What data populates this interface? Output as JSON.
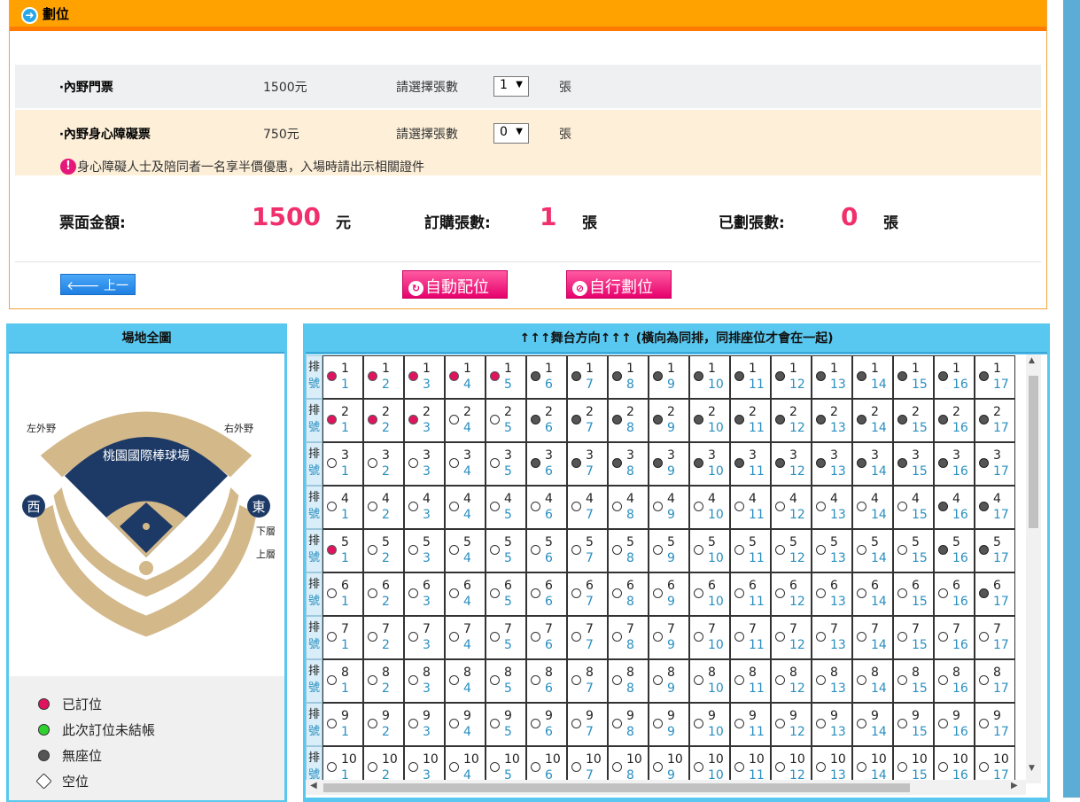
{
  "header": {
    "title": "劃位",
    "icon": "arrow-right-icon"
  },
  "tickets": [
    {
      "name": "‧內野門票",
      "price": "1500元",
      "prompt": "請選擇張數",
      "qty": "1",
      "unit": "張"
    },
    {
      "name": "‧內野身心障礙票",
      "price": "750元",
      "prompt": "請選擇張數",
      "qty": "0",
      "unit": "張",
      "note": "身心障礙人士及陪同者一名享半價優惠，入場時請出示相關證件"
    }
  ],
  "summary": {
    "amount_label": "票面金額:",
    "amount": "1500",
    "amount_unit": "元",
    "ordered_label": "訂購張數:",
    "ordered": "1",
    "ordered_unit": "張",
    "assigned_label": "已劃張數:",
    "assigned": "0",
    "assigned_unit": "張"
  },
  "buttons": {
    "back": "上一步",
    "auto": "自動配位",
    "self": "自行劃位"
  },
  "map": {
    "title": "場地全圖",
    "venue_name": "桃園國際棒球場",
    "labels": {
      "left_outfield": "左外野",
      "right_outfield": "右外野",
      "west": "西",
      "east": "東",
      "lower": "下層",
      "upper": "上層"
    }
  },
  "legend": [
    {
      "label": "已訂位",
      "color": "#e0145e",
      "state": "booked"
    },
    {
      "label": "此次訂位未結帳",
      "color": "#2ed12e",
      "state": "pending"
    },
    {
      "label": "無座位",
      "color": "#555555",
      "state": "noseat"
    },
    {
      "label": "空位",
      "color": "#ffffff",
      "state": "empty"
    }
  ],
  "seat_panel": {
    "title": "↑↑↑舞台方向↑↑↑ (橫向為同排，同排座位才會在一起)",
    "row_head_top": "排",
    "row_head_bottom": "號",
    "visible_rows": [
      1,
      2,
      3,
      4,
      5,
      6,
      7,
      8,
      9,
      10
    ],
    "visible_seats": [
      1,
      2,
      3,
      4,
      5,
      6,
      7,
      8,
      9,
      10,
      11,
      12,
      13,
      14,
      15,
      16,
      17
    ],
    "status_rows": [
      [
        "booked",
        "booked",
        "booked",
        "booked",
        "booked",
        "noseat",
        "noseat",
        "noseat",
        "noseat",
        "noseat",
        "noseat",
        "noseat",
        "noseat",
        "noseat",
        "noseat",
        "noseat",
        "noseat"
      ],
      [
        "booked",
        "booked",
        "booked",
        "empty",
        "empty",
        "noseat",
        "noseat",
        "noseat",
        "noseat",
        "noseat",
        "noseat",
        "noseat",
        "noseat",
        "noseat",
        "noseat",
        "noseat",
        "noseat"
      ],
      [
        "empty",
        "empty",
        "empty",
        "empty",
        "empty",
        "noseat",
        "noseat",
        "noseat",
        "noseat",
        "noseat",
        "noseat",
        "noseat",
        "noseat",
        "noseat",
        "noseat",
        "noseat",
        "noseat"
      ],
      [
        "empty",
        "empty",
        "empty",
        "empty",
        "empty",
        "empty",
        "empty",
        "empty",
        "empty",
        "empty",
        "empty",
        "empty",
        "empty",
        "empty",
        "empty",
        "noseat",
        "noseat"
      ],
      [
        "booked",
        "empty",
        "empty",
        "empty",
        "empty",
        "empty",
        "empty",
        "empty",
        "empty",
        "empty",
        "empty",
        "empty",
        "empty",
        "empty",
        "empty",
        "noseat",
        "noseat"
      ],
      [
        "empty",
        "empty",
        "empty",
        "empty",
        "empty",
        "empty",
        "empty",
        "empty",
        "empty",
        "empty",
        "empty",
        "empty",
        "empty",
        "empty",
        "empty",
        "empty",
        "noseat"
      ],
      [
        "empty",
        "empty",
        "empty",
        "empty",
        "empty",
        "empty",
        "empty",
        "empty",
        "empty",
        "empty",
        "empty",
        "empty",
        "empty",
        "empty",
        "empty",
        "empty",
        "empty"
      ],
      [
        "empty",
        "empty",
        "empty",
        "empty",
        "empty",
        "empty",
        "empty",
        "empty",
        "empty",
        "empty",
        "empty",
        "empty",
        "empty",
        "empty",
        "empty",
        "empty",
        "empty"
      ],
      [
        "empty",
        "empty",
        "empty",
        "empty",
        "empty",
        "empty",
        "empty",
        "empty",
        "empty",
        "empty",
        "empty",
        "empty",
        "empty",
        "empty",
        "empty",
        "empty",
        "empty"
      ],
      [
        "empty",
        "empty",
        "empty",
        "empty",
        "empty",
        "empty",
        "empty",
        "empty",
        "empty",
        "empty",
        "empty",
        "empty",
        "empty",
        "empty",
        "empty",
        "empty",
        "empty"
      ]
    ]
  }
}
